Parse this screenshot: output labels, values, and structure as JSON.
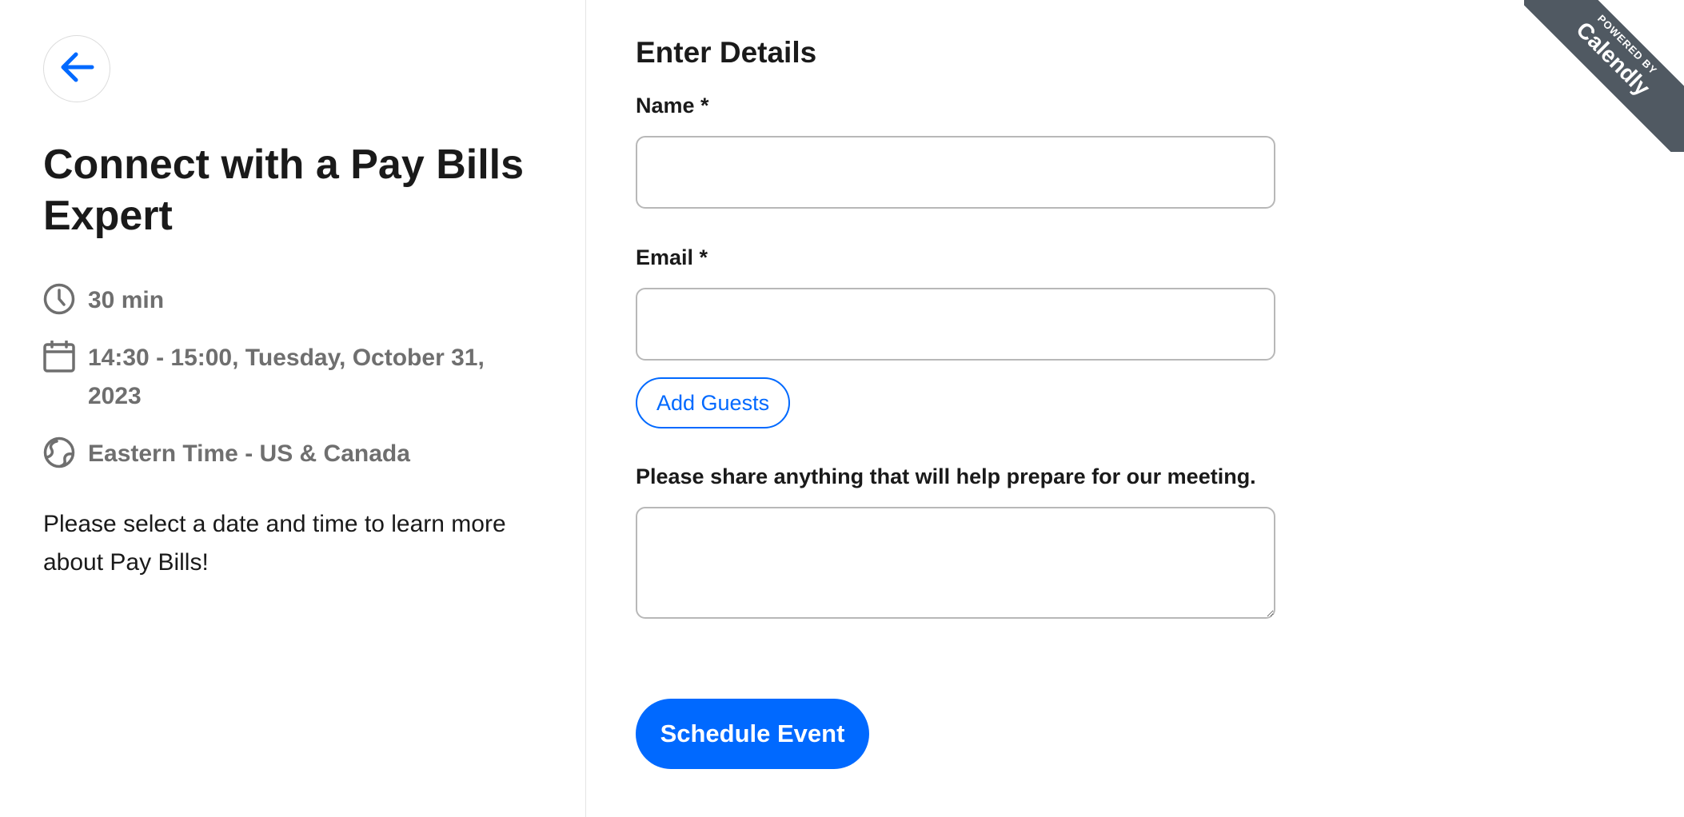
{
  "left_panel": {
    "back_icon": "arrow-left-icon",
    "title": "Connect with a Pay Bills Expert",
    "details": {
      "duration": "30 min",
      "datetime": "14:30 - 15:00, Tuesday, October 31, 2023",
      "timezone": "Eastern Time - US & Canada"
    },
    "icons": {
      "duration": "clock-icon",
      "datetime": "calendar-icon",
      "timezone": "globe-icon"
    },
    "description": "Please select a date and time to learn more about Pay Bills!"
  },
  "form": {
    "title": "Enter Details",
    "name_label": "Name *",
    "name_value": "",
    "email_label": "Email *",
    "email_value": "",
    "add_guests_label": "Add Guests",
    "notes_label": "Please share anything that will help prepare for our meeting.",
    "notes_value": "",
    "submit_label": "Schedule Event"
  },
  "ribbon": {
    "small": "POWERED BY",
    "brand": "Calendly"
  },
  "colors": {
    "accent": "#0069ff",
    "muted_text": "#6f6f6f",
    "ribbon": "#505962"
  }
}
